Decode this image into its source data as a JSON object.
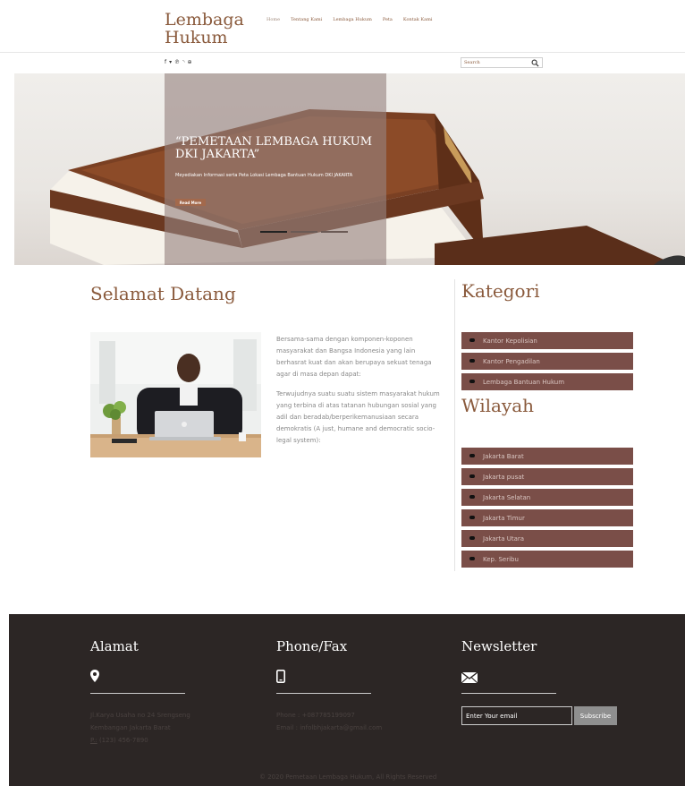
{
  "header": {
    "logo_line1": "Lembaga",
    "logo_line2": "Hukum",
    "nav": [
      "Home",
      "Tentang Kami",
      "Lembaga Hukum",
      "Peta",
      "Kontak Kami"
    ],
    "social_icons": [
      "facebook-icon",
      "twitter-icon",
      "pinterest-icon",
      "rss-icon",
      "dribbble-icon"
    ],
    "search_placeholder": "Search"
  },
  "hero": {
    "title": "“PEMETAAN LEMBAGA HUKUM DKI JAKARTA”",
    "description": "Meyediakan Informasi serta Peta Lokasi Lembaga Bantuan Hukum DKI JAKARTA",
    "read_more": "Read More",
    "slides": 3,
    "active_slide": 1
  },
  "welcome": {
    "title": "Selamat Datang",
    "paragraph1": "Bersama-sama dengan komponen-koponen masyarakat dan Bangsa Indonesia yang lain berhasrat kuat dan akan berupaya sekuat tenaga agar di masa depan dapat:",
    "paragraph2": "Terwujudnya suatu suatu sistem masyarakat hukum yang terbina di atas tatanan hubungan sosial yang adil dan beradab/berperikemanusiaan secara demokratis (A just, humane and democratic socio-legal system):"
  },
  "sidebar": {
    "kategori_title": "Kategori",
    "kategori": [
      "Kantor Kepolisian",
      "Kantor Pengadilan",
      "Lembaga Bantuan Hukum"
    ],
    "wilayah_title": "Wilayah",
    "wilayah": [
      "Jakarta Barat",
      "Jakarta pusat",
      "Jakarta Selatan",
      "Jakarta Timur",
      "Jakarta Utara",
      "Kep. Seribu"
    ]
  },
  "footer": {
    "alamat_title": "Alamat",
    "alamat_line1": "Jl.Karya Usaha no 24 Srengseng",
    "alamat_line2": "Kembangan Jakarta Barat",
    "alamat_phone_label": "P.:",
    "alamat_phone": " (123) 456-7890",
    "phone_title": "Phone/Fax",
    "phone_line": "Phone : +087785199097",
    "email_line": "Email : infolbhjakarta@gmail.com",
    "newsletter_title": "Newsletter",
    "email_placeholder": "Enter Your email",
    "subscribe": "Subscribe",
    "copyright": "© 2020 Pemetaan Lembaga Hukum, All Rights Reserved"
  },
  "colors": {
    "brand": "#8a5a3c",
    "list_bg": "#7a4e48",
    "footer_bg": "#2c2625",
    "button": "#a3694c"
  }
}
